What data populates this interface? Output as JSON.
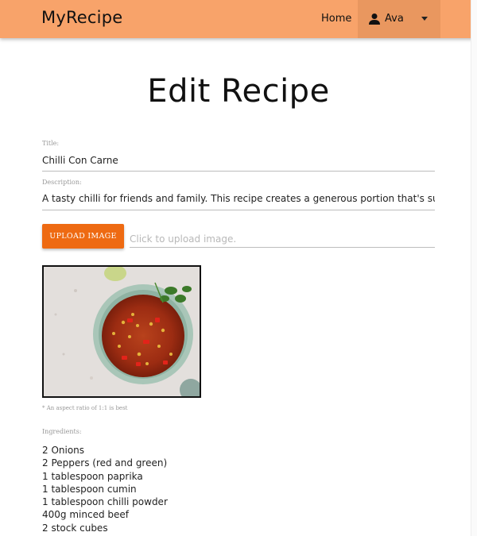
{
  "navbar": {
    "brand": "MyRecipe",
    "home_label": "Home",
    "user_name": "Ava",
    "background_color": "#f8a36a"
  },
  "page": {
    "title": "Edit Recipe"
  },
  "form": {
    "title_label": "Title:",
    "title_value": "Chilli Con Carne",
    "description_label": "Description:",
    "description_value": "A tasty chilli for friends and family. This recipe creates a generous portion that's sure to put a s",
    "upload_button": "UPLOAD IMAGE",
    "upload_placeholder": "Click to upload image.",
    "image_hint": "* An aspect ratio of 1:1 is best",
    "ingredients_label": "Ingredients:",
    "ingredients": [
      "2 Onions",
      "2 Peppers (red and green)",
      "1 tablespoon paprika",
      "1 tablespoon cumin",
      "1 tablespoon chilli powder",
      "400g minced beef",
      "2 stock cubes"
    ],
    "accent_color": "#ee6a12"
  },
  "icons": {
    "user": "person-icon",
    "dropdown": "caret-down-icon"
  }
}
